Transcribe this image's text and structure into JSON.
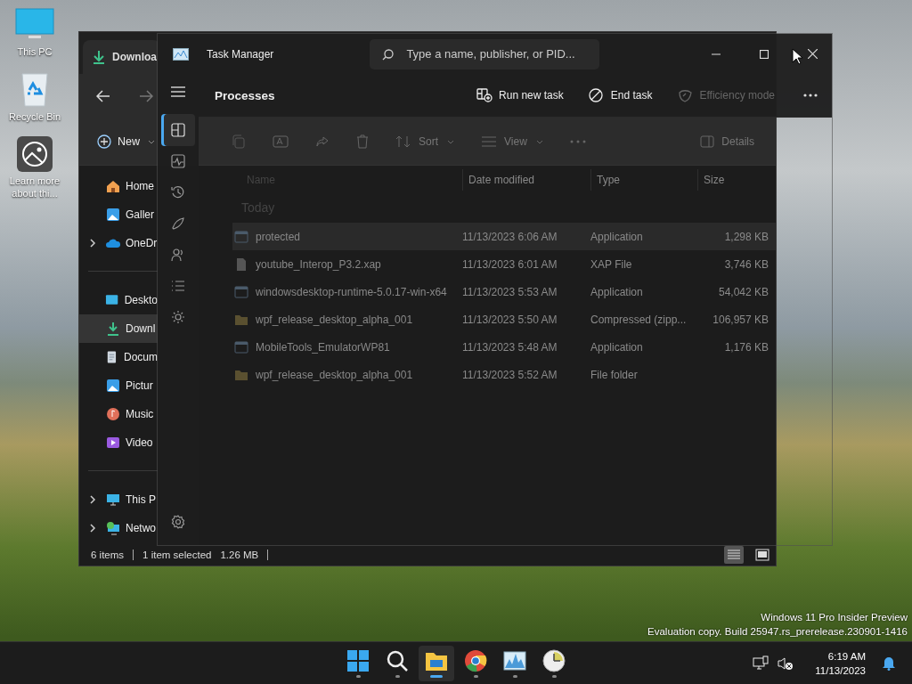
{
  "desktop_icons": [
    {
      "kind": "pc",
      "label": "This PC"
    },
    {
      "kind": "recycle",
      "label": "Recycle Bin"
    },
    {
      "kind": "learn",
      "label": "Learn more about thi..."
    }
  ],
  "file_explorer": {
    "tab_title": "Downloa",
    "new_button": "New",
    "toolbar": [
      {
        "kind": "sort",
        "label": "Sort"
      },
      {
        "kind": "view",
        "label": "View"
      }
    ],
    "details_button": "Details",
    "sidebar_sections": [
      [
        {
          "kind": "home",
          "label": "Home",
          "expandable": false,
          "selected": false
        },
        {
          "kind": "gallery",
          "label": "Galler",
          "expandable": false,
          "selected": false
        },
        {
          "kind": "cloud",
          "label": "OneDr",
          "expandable": true,
          "selected": false
        }
      ],
      [
        {
          "kind": "desktop",
          "label": "Deskto",
          "expandable": false,
          "selected": false
        },
        {
          "kind": "download",
          "label": "Downl",
          "expandable": false,
          "selected": true
        },
        {
          "kind": "document",
          "label": "Docum",
          "expandable": false,
          "selected": false
        },
        {
          "kind": "pictures",
          "label": "Pictur",
          "expandable": false,
          "selected": false
        },
        {
          "kind": "music",
          "label": "Music",
          "expandable": false,
          "selected": false
        },
        {
          "kind": "videos",
          "label": "Video",
          "expandable": false,
          "selected": false
        }
      ],
      [
        {
          "kind": "pc",
          "label": "This P",
          "expandable": true,
          "selected": false
        },
        {
          "kind": "network",
          "label": "Netwo",
          "expandable": true,
          "selected": false
        }
      ]
    ],
    "columns": [
      "Name",
      "Date modified",
      "Type",
      "Size"
    ],
    "group": "Today",
    "rows": [
      {
        "kind": "app",
        "name": "protected",
        "date": "11/13/2023 6:06 AM",
        "type": "Application",
        "size": "1,298 KB",
        "selected": true
      },
      {
        "kind": "file",
        "name": "youtube_Interop_P3.2.xap",
        "date": "11/13/2023 6:01 AM",
        "type": "XAP File",
        "size": "3,746 KB",
        "selected": false
      },
      {
        "kind": "app",
        "name": "windowsdesktop-runtime-5.0.17-win-x64",
        "date": "11/13/2023 5:53 AM",
        "type": "Application",
        "size": "54,042 KB",
        "selected": false
      },
      {
        "kind": "zip",
        "name": "wpf_release_desktop_alpha_001",
        "date": "11/13/2023 5:50 AM",
        "type": "Compressed (zipp...",
        "size": "106,957 KB",
        "selected": false
      },
      {
        "kind": "app",
        "name": "MobileTools_EmulatorWP81",
        "date": "11/13/2023 5:48 AM",
        "type": "Application",
        "size": "1,176 KB",
        "selected": false
      },
      {
        "kind": "folder",
        "name": "wpf_release_desktop_alpha_001",
        "date": "11/13/2023 5:52 AM",
        "type": "File folder",
        "selected": false
      }
    ],
    "status": {
      "items": "6 items",
      "selection": "1 item selected",
      "size": "1.26 MB"
    },
    "view_modes": [
      {
        "kind": "details",
        "selected": true
      },
      {
        "kind": "tiles",
        "selected": false
      }
    ]
  },
  "task_manager": {
    "title": "Task Manager",
    "search_placeholder": "Type a name, publisher, or PID...",
    "nav": [
      {
        "kind": "processes",
        "selected": true
      },
      {
        "kind": "performance",
        "selected": false
      },
      {
        "kind": "history",
        "selected": false
      },
      {
        "kind": "startup",
        "selected": false
      },
      {
        "kind": "users",
        "selected": false
      },
      {
        "kind": "details",
        "selected": false
      },
      {
        "kind": "services",
        "selected": false
      },
      {
        "kind": "settings",
        "selected": false
      }
    ],
    "page_title": "Processes",
    "actions": [
      {
        "kind": "run",
        "label": "Run new task",
        "disabled": false
      },
      {
        "kind": "end",
        "label": "End task",
        "disabled": false
      },
      {
        "kind": "efficiency",
        "label": "Efficiency mode",
        "disabled": true
      }
    ]
  },
  "watermark_lines": [
    "Windows 11 Pro Insider Preview",
    "Evaluation copy. Build 25947.rs_prerelease.230901-1416"
  ],
  "taskbar": {
    "apps": [
      {
        "kind": "start",
        "active": false
      },
      {
        "kind": "search",
        "active": false
      },
      {
        "kind": "explorer",
        "active": true
      },
      {
        "kind": "chrome",
        "active": false
      },
      {
        "kind": "monitor",
        "active": false
      },
      {
        "kind": "clock",
        "active": false
      }
    ],
    "time": "6:19 AM",
    "date": "11/13/2023"
  }
}
